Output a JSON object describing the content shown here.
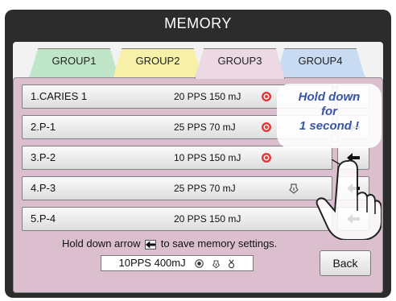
{
  "title": "MEMORY",
  "tabs": [
    {
      "label": "GROUP1"
    },
    {
      "label": "GROUP2"
    },
    {
      "label": "GROUP3"
    },
    {
      "label": "GROUP4"
    }
  ],
  "active_tab": "GROUP3",
  "rows": [
    {
      "name": "1.CARIES 1",
      "pps": "20 PPS",
      "mj": "150 mJ",
      "icon": "target-icon"
    },
    {
      "name": "2.P-1",
      "pps": "25 PPS",
      "mj": " 70 mJ",
      "icon": "target-icon"
    },
    {
      "name": "3.P-2",
      "pps": "10 PPS",
      "mj": "150 mJ",
      "icon": "target-icon"
    },
    {
      "name": "4.P-3",
      "pps": "25 PPS",
      "mj": " 70 mJ",
      "icon": "contact-tip-icon"
    },
    {
      "name": "5.P-4",
      "pps": "20 PPS",
      "mj": "150 mJ",
      "icon": ""
    }
  ],
  "arrow_icon": "save-arrow-icon",
  "instruction": {
    "before": "Hold down arrow",
    "after": "to save memory settings."
  },
  "current_settings": "10PPS 400mJ",
  "settings_icons": [
    "target-icon",
    "contact-tip-icon",
    "tip-icon"
  ],
  "back_label": "Back",
  "callout": {
    "line1": "Hold down",
    "line2": "for",
    "line3": "1 second !"
  },
  "colors": {
    "frame": "#2c2c2c",
    "panel": "#dcbfce",
    "tab_group1": "#bfe6c8",
    "tab_group2": "#f6f0a8",
    "tab_group3": "#ecd9e3",
    "tab_group4": "#c9dbf2",
    "target_red": "#e03a3a",
    "callout_text": "#3a55a6"
  }
}
